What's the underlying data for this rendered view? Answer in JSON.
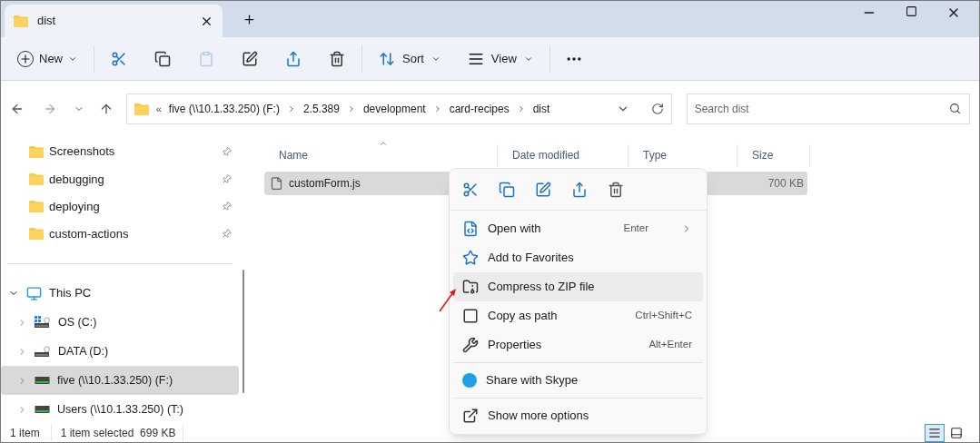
{
  "window": {
    "tab": {
      "title": "dist"
    }
  },
  "toolbar": {
    "new": "New",
    "sort": "Sort",
    "view": "View"
  },
  "address": {
    "overflow": "«",
    "crumbs": [
      "five (\\\\10.1.33.250) (F:)",
      "2.5.389",
      "development",
      "card-recipes",
      "dist"
    ]
  },
  "search": {
    "placeholder": "Search dist"
  },
  "sidebar": {
    "pinned": [
      {
        "label": "Screenshots"
      },
      {
        "label": "debugging"
      },
      {
        "label": "deploying"
      },
      {
        "label": "custom-actions"
      }
    ],
    "tree": [
      {
        "label": "This PC",
        "expanded": true,
        "selected": false,
        "children": [
          {
            "label": "OS (C:)",
            "kind": "system",
            "expanded": false,
            "selected": false
          },
          {
            "label": "DATA (D:)",
            "kind": "local",
            "expanded": false,
            "selected": false
          },
          {
            "label": "five (\\\\10.1.33.250) (F:)",
            "kind": "network",
            "expanded": false,
            "selected": true
          },
          {
            "label": "Users (\\\\10.1.33.250) (T:)",
            "kind": "network",
            "expanded": false,
            "selected": false
          }
        ]
      }
    ]
  },
  "table": {
    "columns": [
      "Name",
      "Date modified",
      "Type",
      "Size"
    ],
    "rows": [
      {
        "name": "customForm.js",
        "size": "700 KB",
        "selected": true
      }
    ]
  },
  "context_menu": {
    "items": [
      {
        "kind": "openwith",
        "label": "Open with",
        "shortcut": "Enter",
        "submenu": true,
        "highlighted": false
      },
      {
        "kind": "favorite",
        "label": "Add to Favorites",
        "submenu": false,
        "highlighted": false
      },
      {
        "kind": "zip",
        "label": "Compress to ZIP file",
        "submenu": false,
        "highlighted": true
      },
      {
        "kind": "copypath",
        "label": "Copy as path",
        "shortcut": "Ctrl+Shift+C",
        "submenu": false,
        "highlighted": false
      },
      {
        "kind": "properties",
        "label": "Properties",
        "shortcut": "Alt+Enter",
        "submenu": false,
        "highlighted": false
      },
      {
        "kind": "skype",
        "label": "Share with Skype",
        "submenu": false,
        "highlighted": false,
        "divider_before": true
      },
      {
        "kind": "more",
        "label": "Show more options",
        "submenu": false,
        "highlighted": false,
        "divider_before": true
      }
    ]
  },
  "status_bar": {
    "count": "1 item",
    "selection": "1 item selected  699 KB",
    "views": [
      {
        "kind": "details",
        "selected": true
      },
      {
        "kind": "tiles",
        "selected": false
      }
    ]
  }
}
